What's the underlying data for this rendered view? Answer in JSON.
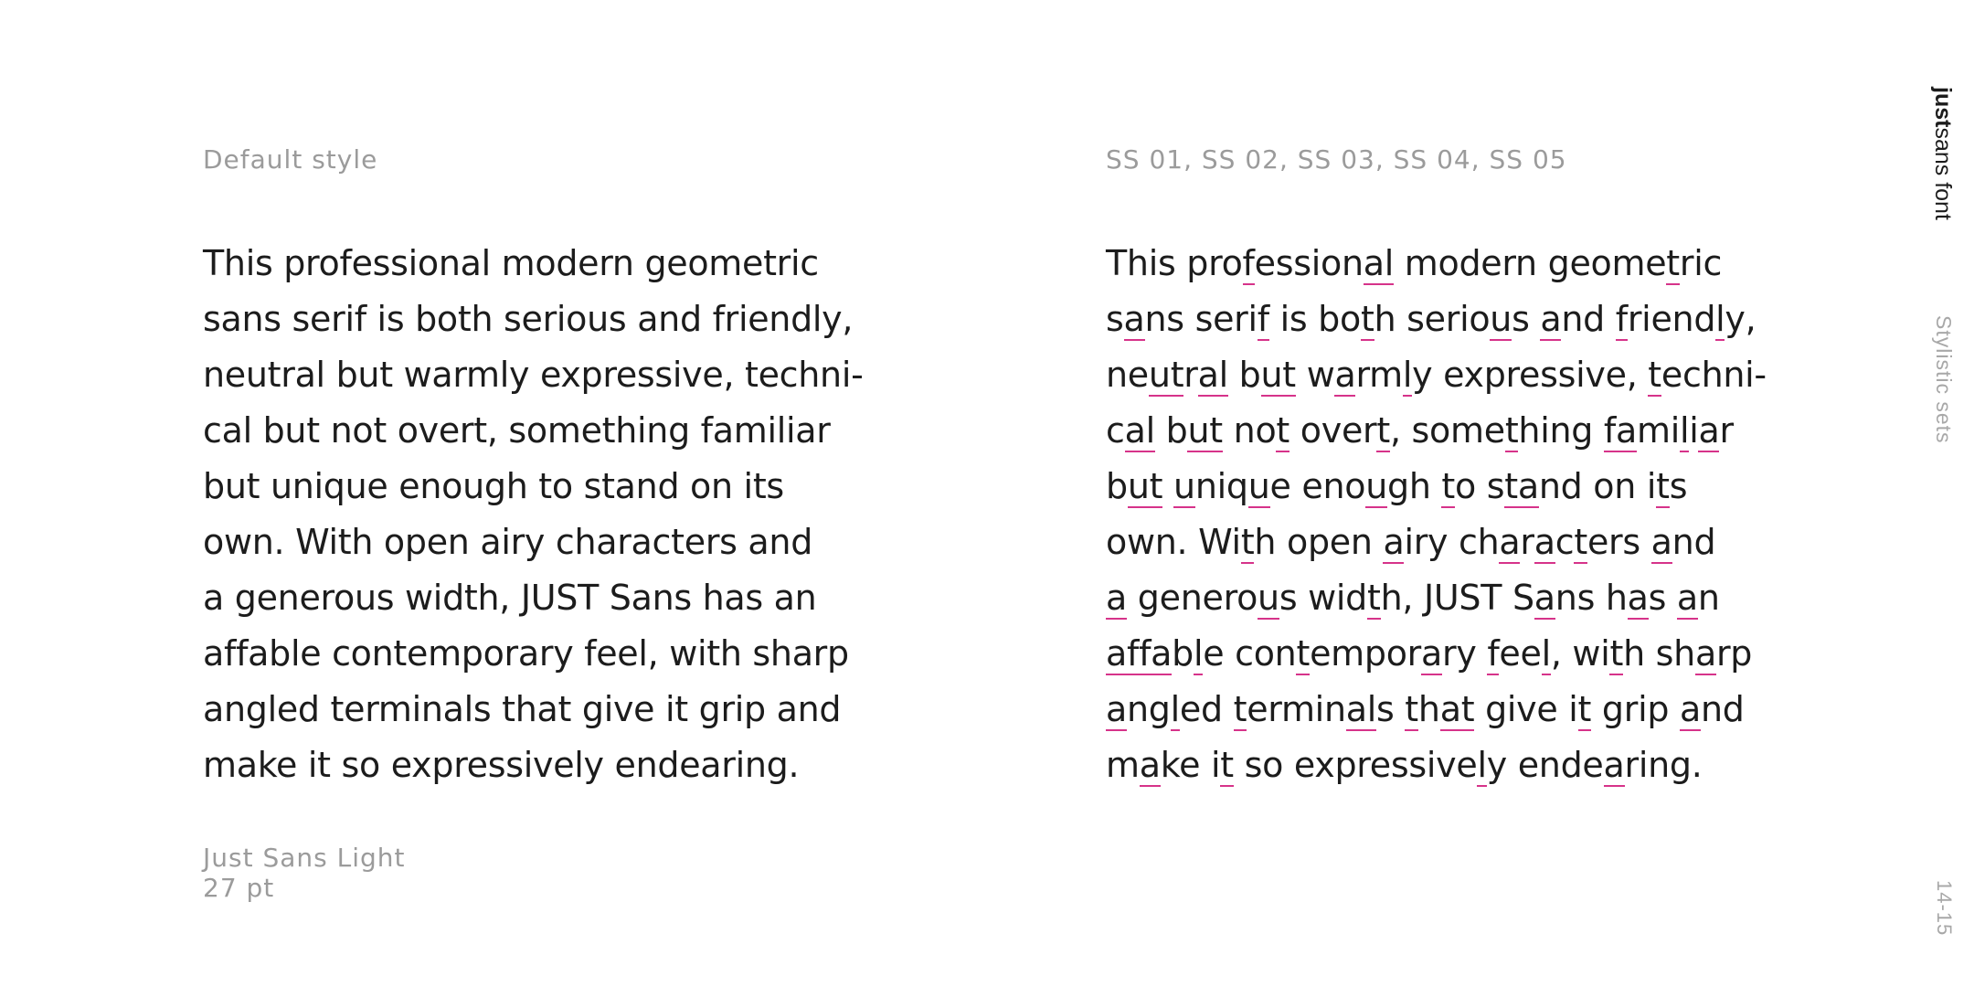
{
  "left": {
    "title": "Default style",
    "lines": [
      "This professional modern geometric",
      "sans serif is both serious and friendly,",
      "neutral but warmly expressive, techni-",
      "cal but not overt, something familiar",
      "but unique enough to stand on its",
      "own. With open airy characters and",
      "a generous width, JUST Sans has an",
      "affable contemporary feel, with sharp",
      "angled terminals that give it grip and",
      "make it so expressively endearing."
    ],
    "font_name": "Just Sans Light",
    "font_size": "27 pt"
  },
  "right": {
    "title": "SS 01, SS 02, SS 03, SS 04, SS 05",
    "lines": [
      "This professional modern geometric",
      "sans serif is both serious and friendly,",
      "neutral but warmly expressive, techni-",
      "cal but not overt, something familiar",
      "but unique enough to stand on its",
      "own. With open airy characters and",
      "a generous width, JUST Sans has an",
      "affable contemporary feel, with sharp",
      "angled terminals that give it grip and",
      "make it so expressively endearing."
    ],
    "accent_color": "#d6338a"
  },
  "side": {
    "brand_bold": "just",
    "brand_rest": "sans font",
    "section": "Stylistic sets",
    "pages": "14-15"
  }
}
